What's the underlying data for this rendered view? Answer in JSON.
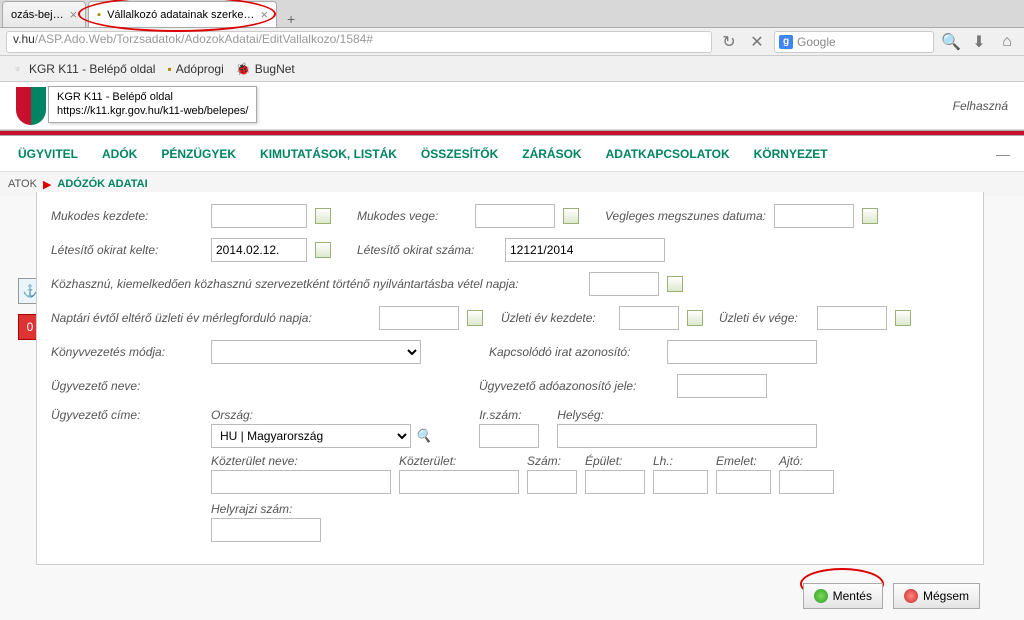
{
  "tabs": {
    "items": [
      "ozás-bej…",
      "Vállalkozó adatainak szerke…"
    ]
  },
  "url": {
    "prefix": "v.hu",
    "path": "/ASP.Ado.Web/Torzsadatok/AdozokAdatai/EditVallalkozo/1584#"
  },
  "search": {
    "placeholder": "Google"
  },
  "bookmarks": [
    "KGR K11 - Belépő oldal",
    "Adóprogi",
    "BugNet"
  ],
  "tooltip": {
    "line1": "KGR K11 - Belépő oldal",
    "line2": "https://k11.kgr.gov.hu/k11-web/belepes/"
  },
  "user_label": "Felhaszná",
  "menu": [
    "ÜGYVITEL",
    "ADÓK",
    "PÉNZÜGYEK",
    "KIMUTATÁSOK, LISTÁK",
    "ÖSSZESÍTŐK",
    "ZÁRÁSOK",
    "ADATKAPCSOLATOK",
    "KÖRNYEZET"
  ],
  "breadcrumb": {
    "prev": "ATOK",
    "current": "ADÓZÓK ADATAI"
  },
  "sidetabs": {
    "anchor": "⚓",
    "error": "0"
  },
  "form": {
    "mukodes_kezdete_lbl": "Mukodes kezdete:",
    "mukodes_vege_lbl": "Mukodes vege:",
    "vegleges_lbl": "Vegleges megszunes datuma:",
    "letesito_kelte_lbl": "Létesítő okirat kelte:",
    "letesito_kelte_val": "2014.02.12.",
    "letesito_szama_lbl": "Létesítő okirat száma:",
    "letesito_szama_val": "12121/2014",
    "kozhasznu_lbl": "Közhasznú, kiemelkedően közhasznú szervezetként történő nyilvántartásba vétel napja:",
    "naptari_lbl": "Naptári évtől eltérő üzleti év mérlegforduló napja:",
    "uzleti_kezdete_lbl": "Üzleti év kezdete:",
    "uzleti_vege_lbl": "Üzleti év vége:",
    "konyv_lbl": "Könyvvezetés módja:",
    "kapcs_irat_lbl": "Kapcsolódó irat azonosító:",
    "ugyvez_neve_lbl": "Ügyvezető neve:",
    "ugyvez_ado_lbl": "Ügyvezető adóazonosító jele:",
    "ugyvez_cime_lbl": "Ügyvezető címe:",
    "orszag_lbl": "Ország:",
    "orszag_val": "HU | Magyarország",
    "irszam_lbl": "Ir.szám:",
    "helyseg_lbl": "Helység:",
    "kozterulet_neve_lbl": "Közterület neve:",
    "kozterulet_lbl": "Közterület:",
    "szam_lbl": "Szám:",
    "epulet_lbl": "Épület:",
    "lh_lbl": "Lh.:",
    "emelet_lbl": "Emelet:",
    "ajto_lbl": "Ajtó:",
    "helyrajzi_lbl": "Helyrajzi szám:"
  },
  "buttons": {
    "save": "Mentés",
    "cancel": "Mégsem"
  }
}
